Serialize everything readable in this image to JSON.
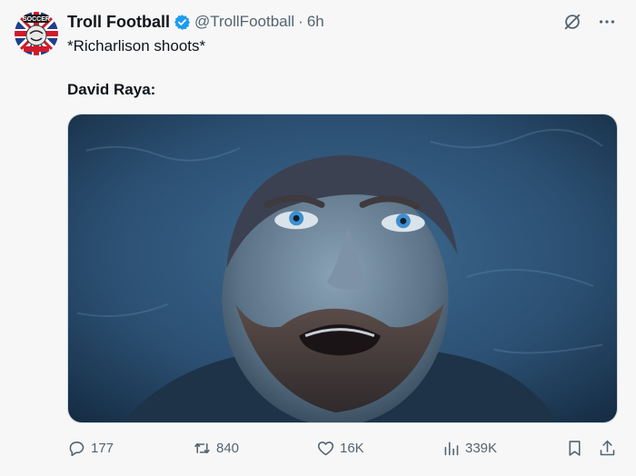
{
  "author": {
    "display_name": "Troll Football",
    "handle": "@TrollFootball",
    "separator": "·",
    "time": "6h",
    "avatar_text": "SOCCER"
  },
  "tweet": {
    "line1": "*Richarlison shoots*",
    "line2": "David Raya:"
  },
  "stats": {
    "replies": "177",
    "retweets": "840",
    "likes": "16K",
    "views": "339K"
  },
  "colors": {
    "verified": "#1d9bf0",
    "secondary_text": "#536471"
  }
}
